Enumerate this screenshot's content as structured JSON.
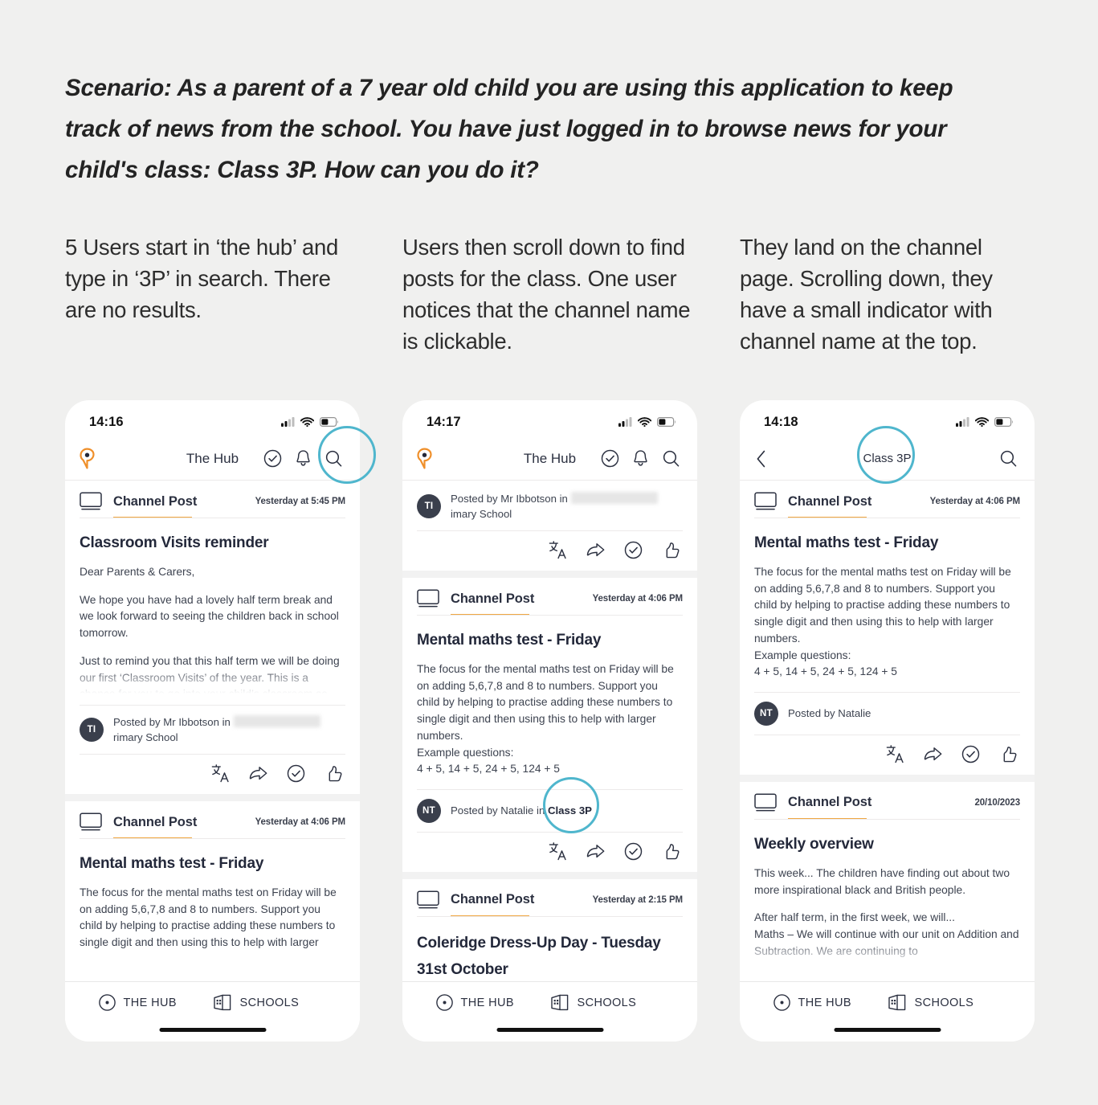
{
  "scenario": {
    "text": "Scenario: As a parent of a 7 year old child you are using this application to keep track of news from the school. You have just logged in to browse news for your child's class: Class 3P. How can you do it?"
  },
  "columns": [
    {
      "caption": "5 Users start in ‘the hub’ and type in ‘3P’ in search. There are no results."
    },
    {
      "caption": "Users then scroll down to find posts for the class. One user notices that the channel name is clickable."
    },
    {
      "caption": "They land on the channel page. Scrolling down, they have a small indicator with channel name at the top."
    }
  ],
  "accent_color": "#f0a742",
  "annotation_color": "#4fb6cd",
  "phone1": {
    "status": {
      "time": "14:16",
      "signal": "cellular-signal-icon",
      "wifi": "wifi-icon",
      "battery": "battery-icon"
    },
    "nav": {
      "logo": "location-pin-icon",
      "title": "The Hub",
      "actions": [
        "check-circle-icon",
        "bell-icon",
        "search-icon"
      ]
    },
    "posts": [
      {
        "kind": "Channel Post",
        "date": "Yesterday at 5:45 PM",
        "title": "Classroom Visits reminder",
        "paragraphs": [
          "Dear Parents & Carers,",
          "We hope you have had a lovely half term break and we look forward to seeing the children back in school tomorrow.",
          "Just to remind you that this half term we will be doing our first ‘Classroom Visits’ of the year. This is a chance for you to go into your child’s classroom so that they can show you their"
        ],
        "author_initials": "TI",
        "author_prefix": "Posted by Mr Ibbotson in",
        "author_suffix": "rimary School",
        "actions": [
          "translate-icon",
          "share-icon",
          "mark-read-icon",
          "like-icon"
        ]
      },
      {
        "kind": "Channel Post",
        "date": "Yesterday at 4:06 PM",
        "title": "Mental maths test - Friday",
        "paragraphs": [
          "The focus for the mental maths test on Friday will be on adding 5,6,7,8 and 8 to numbers. Support you child by helping to practise adding these numbers to single digit and then using this to help with larger numbers."
        ]
      }
    ],
    "tabs": [
      {
        "label": "THE HUB",
        "icon": "hub-dot-icon"
      },
      {
        "label": "SCHOOLS",
        "icon": "school-building-icon"
      }
    ]
  },
  "phone2": {
    "status": {
      "time": "14:17"
    },
    "nav": {
      "logo": "location-pin-icon",
      "title": "The Hub",
      "actions": [
        "check-circle-icon",
        "bell-icon",
        "search-icon"
      ]
    },
    "partial_post": {
      "author_initials": "TI",
      "author_prefix": "Posted by Mr Ibbotson in",
      "author_suffix": "imary School",
      "actions": [
        "translate-icon",
        "share-icon",
        "mark-read-icon",
        "like-icon"
      ]
    },
    "posts": [
      {
        "kind": "Channel Post",
        "date": "Yesterday at 4:06 PM",
        "title": "Mental maths test - Friday",
        "paragraphs": [
          "The focus for the mental maths test on Friday will be on adding 5,6,7,8 and 8 to numbers. Support you child by helping to practise adding these numbers to single digit and then using this to help with larger numbers.\nExample questions:\n4 + 5, 14 + 5, 24 + 5, 124 + 5"
        ],
        "author_initials": "NT",
        "author_prefix": "Posted by Natalie in",
        "author_channel": "Class 3P",
        "actions": [
          "translate-icon",
          "share-icon",
          "mark-read-icon",
          "like-icon"
        ]
      },
      {
        "kind": "Channel Post",
        "date": "Yesterday at 2:15 PM",
        "title": "Coleridge Dress-Up Day - Tuesday 31st October"
      }
    ],
    "tabs": [
      {
        "label": "THE HUB",
        "icon": "hub-dot-icon"
      },
      {
        "label": "SCHOOLS",
        "icon": "school-building-icon"
      }
    ]
  },
  "phone3": {
    "status": {
      "time": "14:18"
    },
    "nav": {
      "back": "back-chevron-icon",
      "title": "Class 3P",
      "actions": [
        "search-icon"
      ]
    },
    "posts": [
      {
        "kind": "Channel Post",
        "date": "Yesterday at 4:06 PM",
        "title": "Mental maths test - Friday",
        "paragraphs": [
          "The focus for the mental maths test on Friday will be on adding 5,6,7,8 and 8 to numbers. Support you child by helping to practise adding these numbers to single digit and then using this to help with larger numbers.\nExample questions:\n4 + 5, 14 + 5, 24 + 5, 124 + 5"
        ],
        "author_initials": "NT",
        "author_prefix": "Posted by Natalie",
        "actions": [
          "translate-icon",
          "share-icon",
          "mark-read-icon",
          "like-icon"
        ]
      },
      {
        "kind": "Channel Post",
        "date": "20/10/2023",
        "title": "Weekly overview",
        "paragraphs": [
          "This week... The children have finding out about two more inspirational black and British people.",
          "After half term, in the first week, we will...\nMaths – We will continue with our unit on Addition and Subtraction. We are continuing to"
        ]
      }
    ],
    "tabs": [
      {
        "label": "THE HUB",
        "icon": "hub-dot-icon"
      },
      {
        "label": "SCHOOLS",
        "icon": "school-building-icon"
      }
    ]
  }
}
